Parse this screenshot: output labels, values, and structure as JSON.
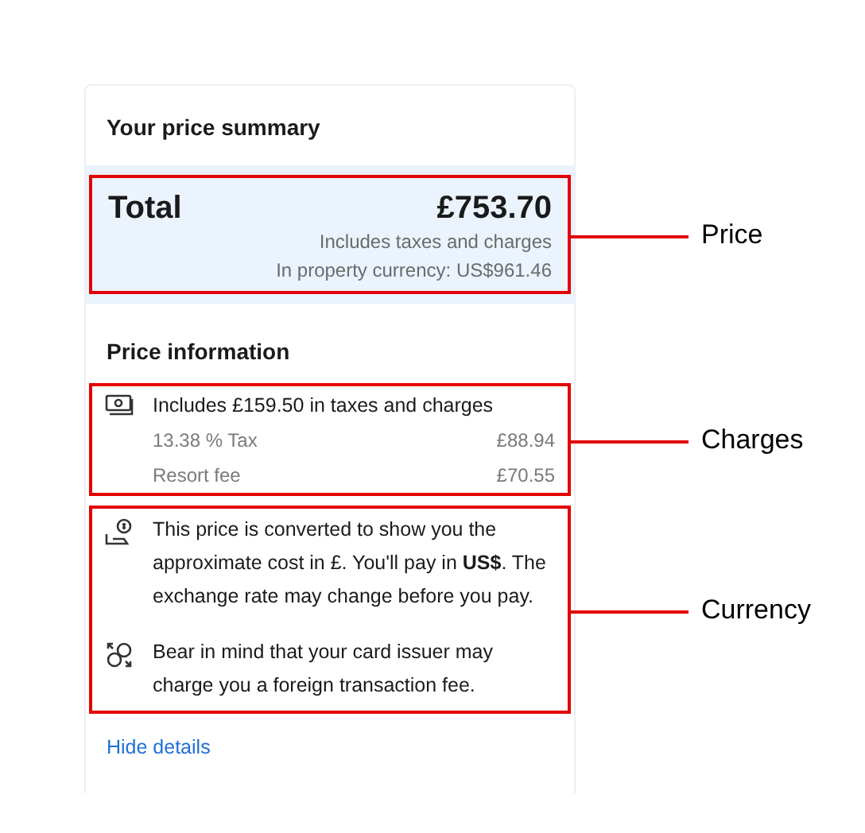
{
  "summary": {
    "title": "Your price summary",
    "total_label": "Total",
    "total": "£753.70",
    "notes": [
      "Includes taxes and charges",
      "In property currency: US$961.46"
    ]
  },
  "price_information": {
    "title": "Price information",
    "charges_heading": "Includes £159.50 in taxes and charges",
    "charges": [
      {
        "name": "13.38 % Tax",
        "amount": "£88.94"
      },
      {
        "name": "Resort fee",
        "amount": "£70.55"
      }
    ],
    "currency_notes": [
      {
        "kind": "converted",
        "text": "This price is converted to show you the approximate cost in £. You'll pay in **US$**. The exchange rate may change before you pay."
      },
      {
        "kind": "exchange",
        "text": "Bear in mind that your card issuer may charge you a foreign transaction fee."
      }
    ]
  },
  "link": "Hide details",
  "annotations": [
    {
      "label": "Price"
    },
    {
      "label": "Charges"
    },
    {
      "label": "Currency"
    }
  ]
}
